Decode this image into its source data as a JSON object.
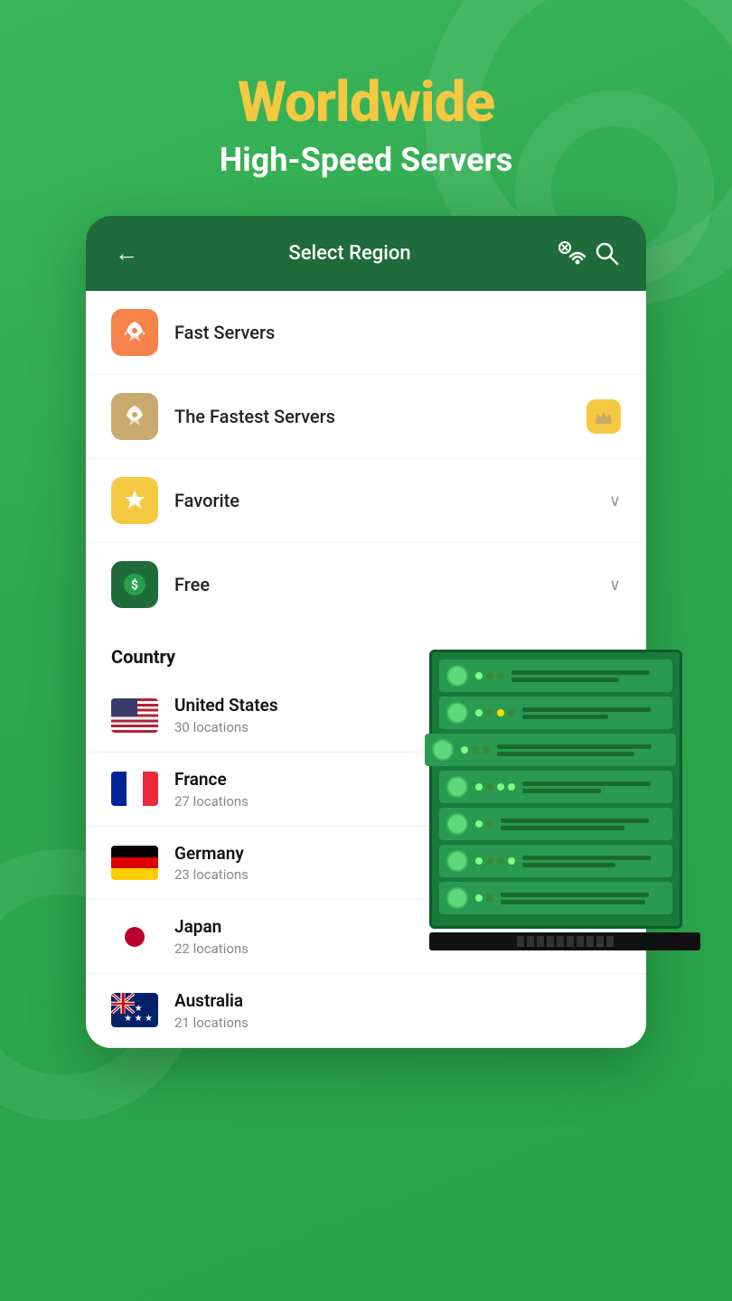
{
  "header": {
    "title_line1": "Worldwide",
    "title_line2": "High-Speed Servers"
  },
  "app": {
    "screen_title": "Select Region",
    "back_label": "←",
    "menu_items": [
      {
        "id": "fast-servers",
        "label": "Fast Servers",
        "icon_type": "rocket-orange",
        "icon_emoji": "🚀",
        "has_chevron": false,
        "has_crown": false
      },
      {
        "id": "fastest-servers",
        "label": "The Fastest Servers",
        "icon_type": "rocket-tan",
        "icon_emoji": "🚀",
        "has_chevron": false,
        "has_crown": true
      },
      {
        "id": "favorite",
        "label": "Favorite",
        "icon_type": "star-yellow",
        "icon_emoji": "⭐",
        "has_chevron": true,
        "has_crown": false
      },
      {
        "id": "free",
        "label": "Free",
        "icon_type": "dollar-green",
        "icon_emoji": "$",
        "has_chevron": true,
        "has_crown": false
      }
    ],
    "country_section_label": "Country",
    "countries": [
      {
        "id": "us",
        "name": "United States",
        "locations": "30 locations",
        "flag": "us"
      },
      {
        "id": "fr",
        "name": "France",
        "locations": "27 locations",
        "flag": "fr"
      },
      {
        "id": "de",
        "name": "Germany",
        "locations": "23 locations",
        "flag": "de"
      },
      {
        "id": "jp",
        "name": "Japan",
        "locations": "22 locations",
        "flag": "jp"
      },
      {
        "id": "au",
        "name": "Australia",
        "locations": "21 locations",
        "flag": "au"
      }
    ]
  },
  "colors": {
    "background_green": "#3cb65a",
    "dark_green": "#1f6b3a",
    "yellow": "#f5c842",
    "white": "#ffffff"
  }
}
